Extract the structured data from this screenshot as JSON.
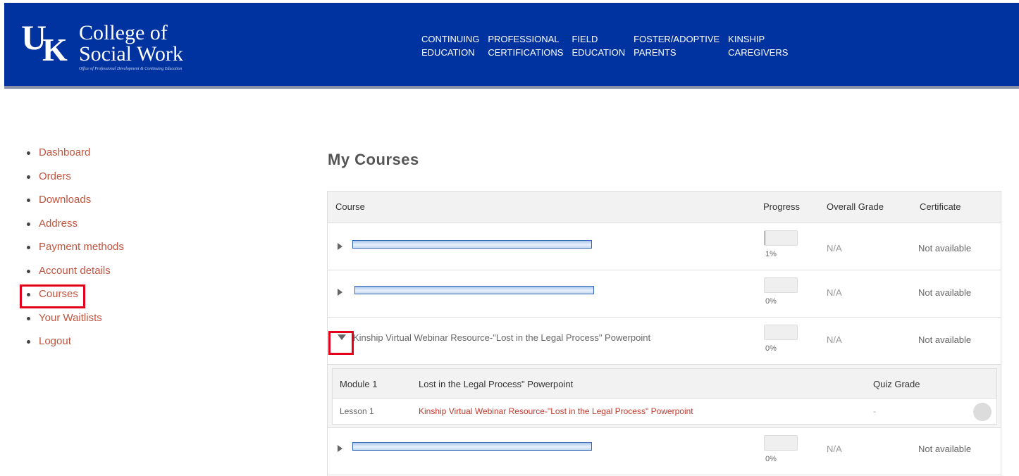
{
  "header": {
    "logo": {
      "mark": [
        "U",
        "K"
      ],
      "title_line1": "College of",
      "title_line2": "Social Work",
      "subtitle": "Office of Professional Development & Continuing Education"
    },
    "nav": [
      {
        "line1": "CONTINUING",
        "line2": "EDUCATION"
      },
      {
        "line1": "PROFESSIONAL",
        "line2": "CERTIFICATIONS"
      },
      {
        "line1": "FIELD",
        "line2": "EDUCATION"
      },
      {
        "line1": "FOSTER/ADOPTIVE",
        "line2": "PARENTS"
      },
      {
        "line1": "KINSHIP",
        "line2": "CAREGIVERS"
      }
    ]
  },
  "sidebar": {
    "items": [
      {
        "label": "Dashboard"
      },
      {
        "label": "Orders"
      },
      {
        "label": "Downloads"
      },
      {
        "label": "Address"
      },
      {
        "label": "Payment methods"
      },
      {
        "label": "Account details"
      },
      {
        "label": "Courses"
      },
      {
        "label": "Your Waitlists"
      },
      {
        "label": "Logout"
      }
    ]
  },
  "main": {
    "title": "My Courses",
    "columns": {
      "course": "Course",
      "progress": "Progress",
      "grade": "Overall Grade",
      "certificate": "Certificate"
    },
    "courses": [
      {
        "name": "",
        "progress_pct": "1%",
        "progress_fraction": 0.01,
        "grade": "N/A",
        "certificate": "Not available"
      },
      {
        "name": "",
        "progress_pct": "0%",
        "progress_fraction": 0,
        "grade": "N/A",
        "certificate": "Not available"
      },
      {
        "name": "Kinship Virtual Webinar Resource-\"Lost in the Legal Process\" Powerpoint",
        "progress_pct": "0%",
        "progress_fraction": 0,
        "grade": "N/A",
        "certificate": "Not available"
      },
      {
        "name": "",
        "progress_pct": "0%",
        "progress_fraction": 0,
        "grade": "N/A",
        "certificate": "Not available"
      }
    ],
    "module": {
      "label": "Module 1",
      "title": "Lost in the Legal Process\" Powerpoint",
      "quiz_header": "Quiz Grade",
      "lesson": {
        "label": "Lesson 1",
        "title": "Kinship Virtual Webinar Resource-\"Lost in the Legal Process\" Powerpoint",
        "quiz_grade": "-"
      }
    }
  },
  "colors": {
    "header_bg": "#0033a0",
    "link": "#c0553f",
    "highlight": "#e4001b",
    "progress_fill": "#37a447"
  }
}
